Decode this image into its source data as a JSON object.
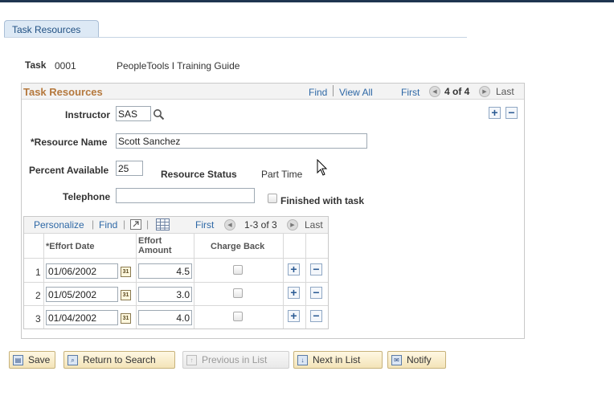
{
  "tab": {
    "label": "Task Resources"
  },
  "task": {
    "label": "Task",
    "id": "0001",
    "description": "PeopleTools I Training Guide"
  },
  "section": {
    "title": "Task Resources",
    "find": "Find",
    "view_all": "View All",
    "first": "First",
    "count": "4 of 4",
    "last": "Last"
  },
  "form": {
    "instructor_label": "Instructor",
    "instructor_value": "SAS",
    "resource_name_label": "*Resource Name",
    "resource_name_value": "Scott Sanchez",
    "percent_label": "Percent Available",
    "percent_value": "25",
    "status_label": "Resource Status",
    "status_value": "Part Time",
    "telephone_label": "Telephone",
    "telephone_value": "",
    "finished_label": "Finished with task"
  },
  "grid": {
    "personalize": "Personalize",
    "find": "Find",
    "first": "First",
    "count": "1-3 of 3",
    "last": "Last",
    "col_date": "*Effort Date",
    "col_amount": "Effort Amount",
    "col_charge": "Charge Back",
    "rows": [
      {
        "num": "1",
        "date": "01/06/2002",
        "amount": "4.5"
      },
      {
        "num": "2",
        "date": "01/05/2002",
        "amount": "3.0"
      },
      {
        "num": "3",
        "date": "01/04/2002",
        "amount": "4.0"
      }
    ]
  },
  "buttons": {
    "save": "Save",
    "return": "Return to Search",
    "previous": "Previous in List",
    "next": "Next in List",
    "notify": "Notify"
  }
}
